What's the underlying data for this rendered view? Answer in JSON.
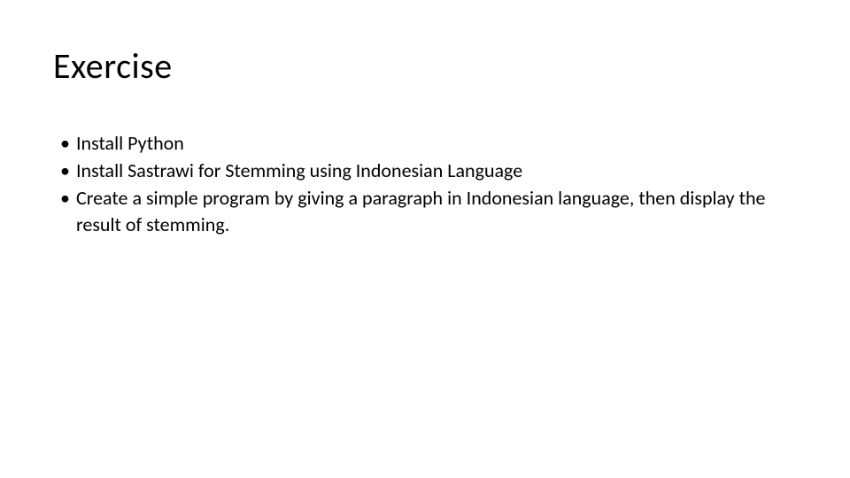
{
  "slide": {
    "title": "Exercise",
    "bullets": [
      "Install Python",
      "Install Sastrawi for Stemming using Indonesian Language",
      "Create a simple program by giving a paragraph in Indonesian language, then display the  result of stemming."
    ]
  }
}
